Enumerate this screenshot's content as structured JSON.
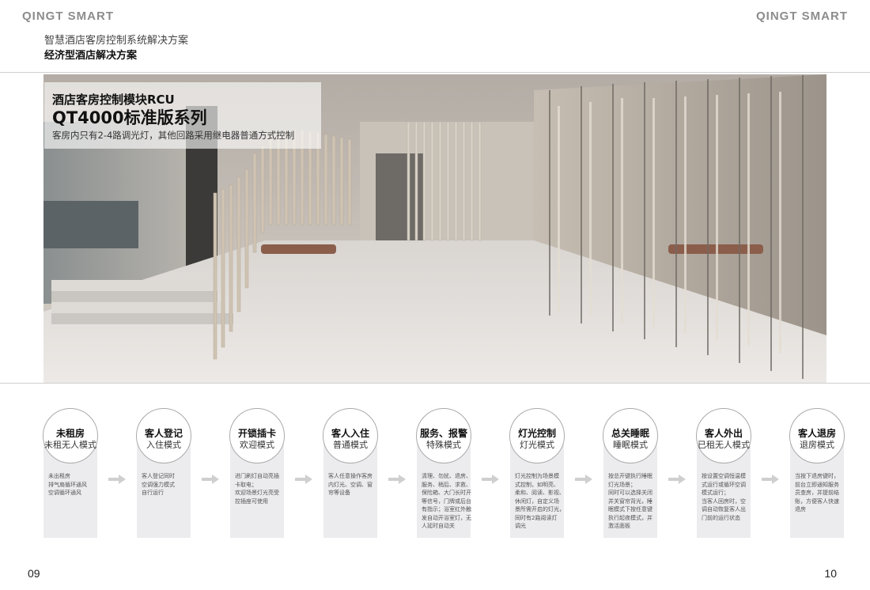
{
  "header": {
    "brand_left": "QINGT SMART",
    "brand_right": "QINGT SMART",
    "subtitle": "智慧酒店客房控制系统解决方案",
    "title": "经济型酒店解决方案"
  },
  "hero": {
    "caption_line1": "酒店客房控制模块RCU",
    "caption_line2": "QT4000标准版系列",
    "caption_line3": "客房内只有2-4路调光灯，其他回路采用继电器普通方式控制"
  },
  "steps": [
    {
      "name": "未租房",
      "mode": "未租无人模式",
      "desc": "未出租房\n排气扇循环通风\n空调循环通风"
    },
    {
      "name": "客人登记",
      "mode": "入住模式",
      "desc": "客人登记同时\n空调强力模式\n自行运行"
    },
    {
      "name": "开锁插卡",
      "mode": "欢迎模式",
      "desc": "进门刷灯自动亮插\n卡取电；\n欢迎场景灯光亮受\n控插座可使用"
    },
    {
      "name": "客人入住",
      "mode": "普通模式",
      "desc": "客人任意操作客房\n内灯光、空调、窗\n帘等设备"
    },
    {
      "name": "服务、报警",
      "mode": "特殊模式",
      "desc": "清理、勿扰、退房、\n服务、稍后、求救、\n保险箱、大门长时开\n等信号，门牌或后台\n有指示；浴室红外触\n发自动开浴室灯，无\n人延时自动关"
    },
    {
      "name": "灯光控制",
      "mode": "灯光模式",
      "desc": "灯光控制为场景模\n式控制，如明亮、\n柔和、阅读、影视、\n休闲灯，自定义场\n景所需开启的灯光，\n同时有2路阅读灯\n调光"
    },
    {
      "name": "总关睡眠",
      "mode": "睡眠模式",
      "desc": "按总开键执行睡眠\n灯光场景；\n同时可以选择关闭\n并关窗帘背光，睡\n眠模式下按任意键\n执行起夜模式，并\n激活面板"
    },
    {
      "name": "客人外出",
      "mode": "已租无人模式",
      "desc": "按设置空调恒温模\n式运行或循环空调\n模式运行；\n当客人回房时，空\n调自动恢复客人出\n门前的运行状态"
    },
    {
      "name": "客人退房",
      "mode": "退房模式",
      "desc": "当按下退房键时，\n前台立即通知服务\n员查房，并提前结\n账，方便客人快速\n退房"
    }
  ],
  "footer": {
    "page_left": "09",
    "page_right": "10"
  }
}
